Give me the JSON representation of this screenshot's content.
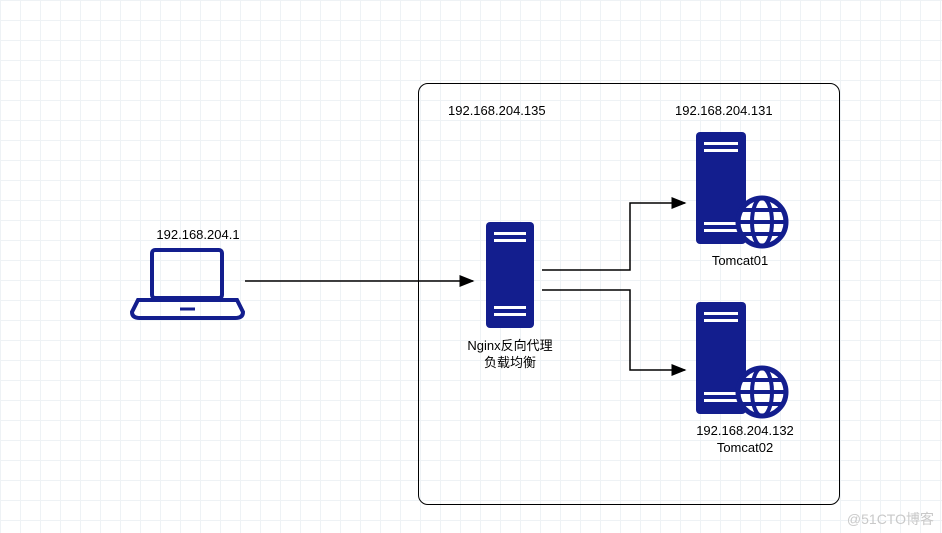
{
  "client": {
    "ip_label": "192.168.204.1"
  },
  "nginx": {
    "ip_label": "192.168.204.135",
    "caption_line1": "Nginx反向代理",
    "caption_line2": "负载均衡"
  },
  "tomcat1": {
    "ip_label": "192.168.204.131",
    "caption": "Tomcat01"
  },
  "tomcat2": {
    "ip_label": "192.168.204.132",
    "caption": "Tomcat02"
  },
  "watermark": "@51CTO博客",
  "colors": {
    "accent": "#131e8e",
    "line": "#000000"
  }
}
